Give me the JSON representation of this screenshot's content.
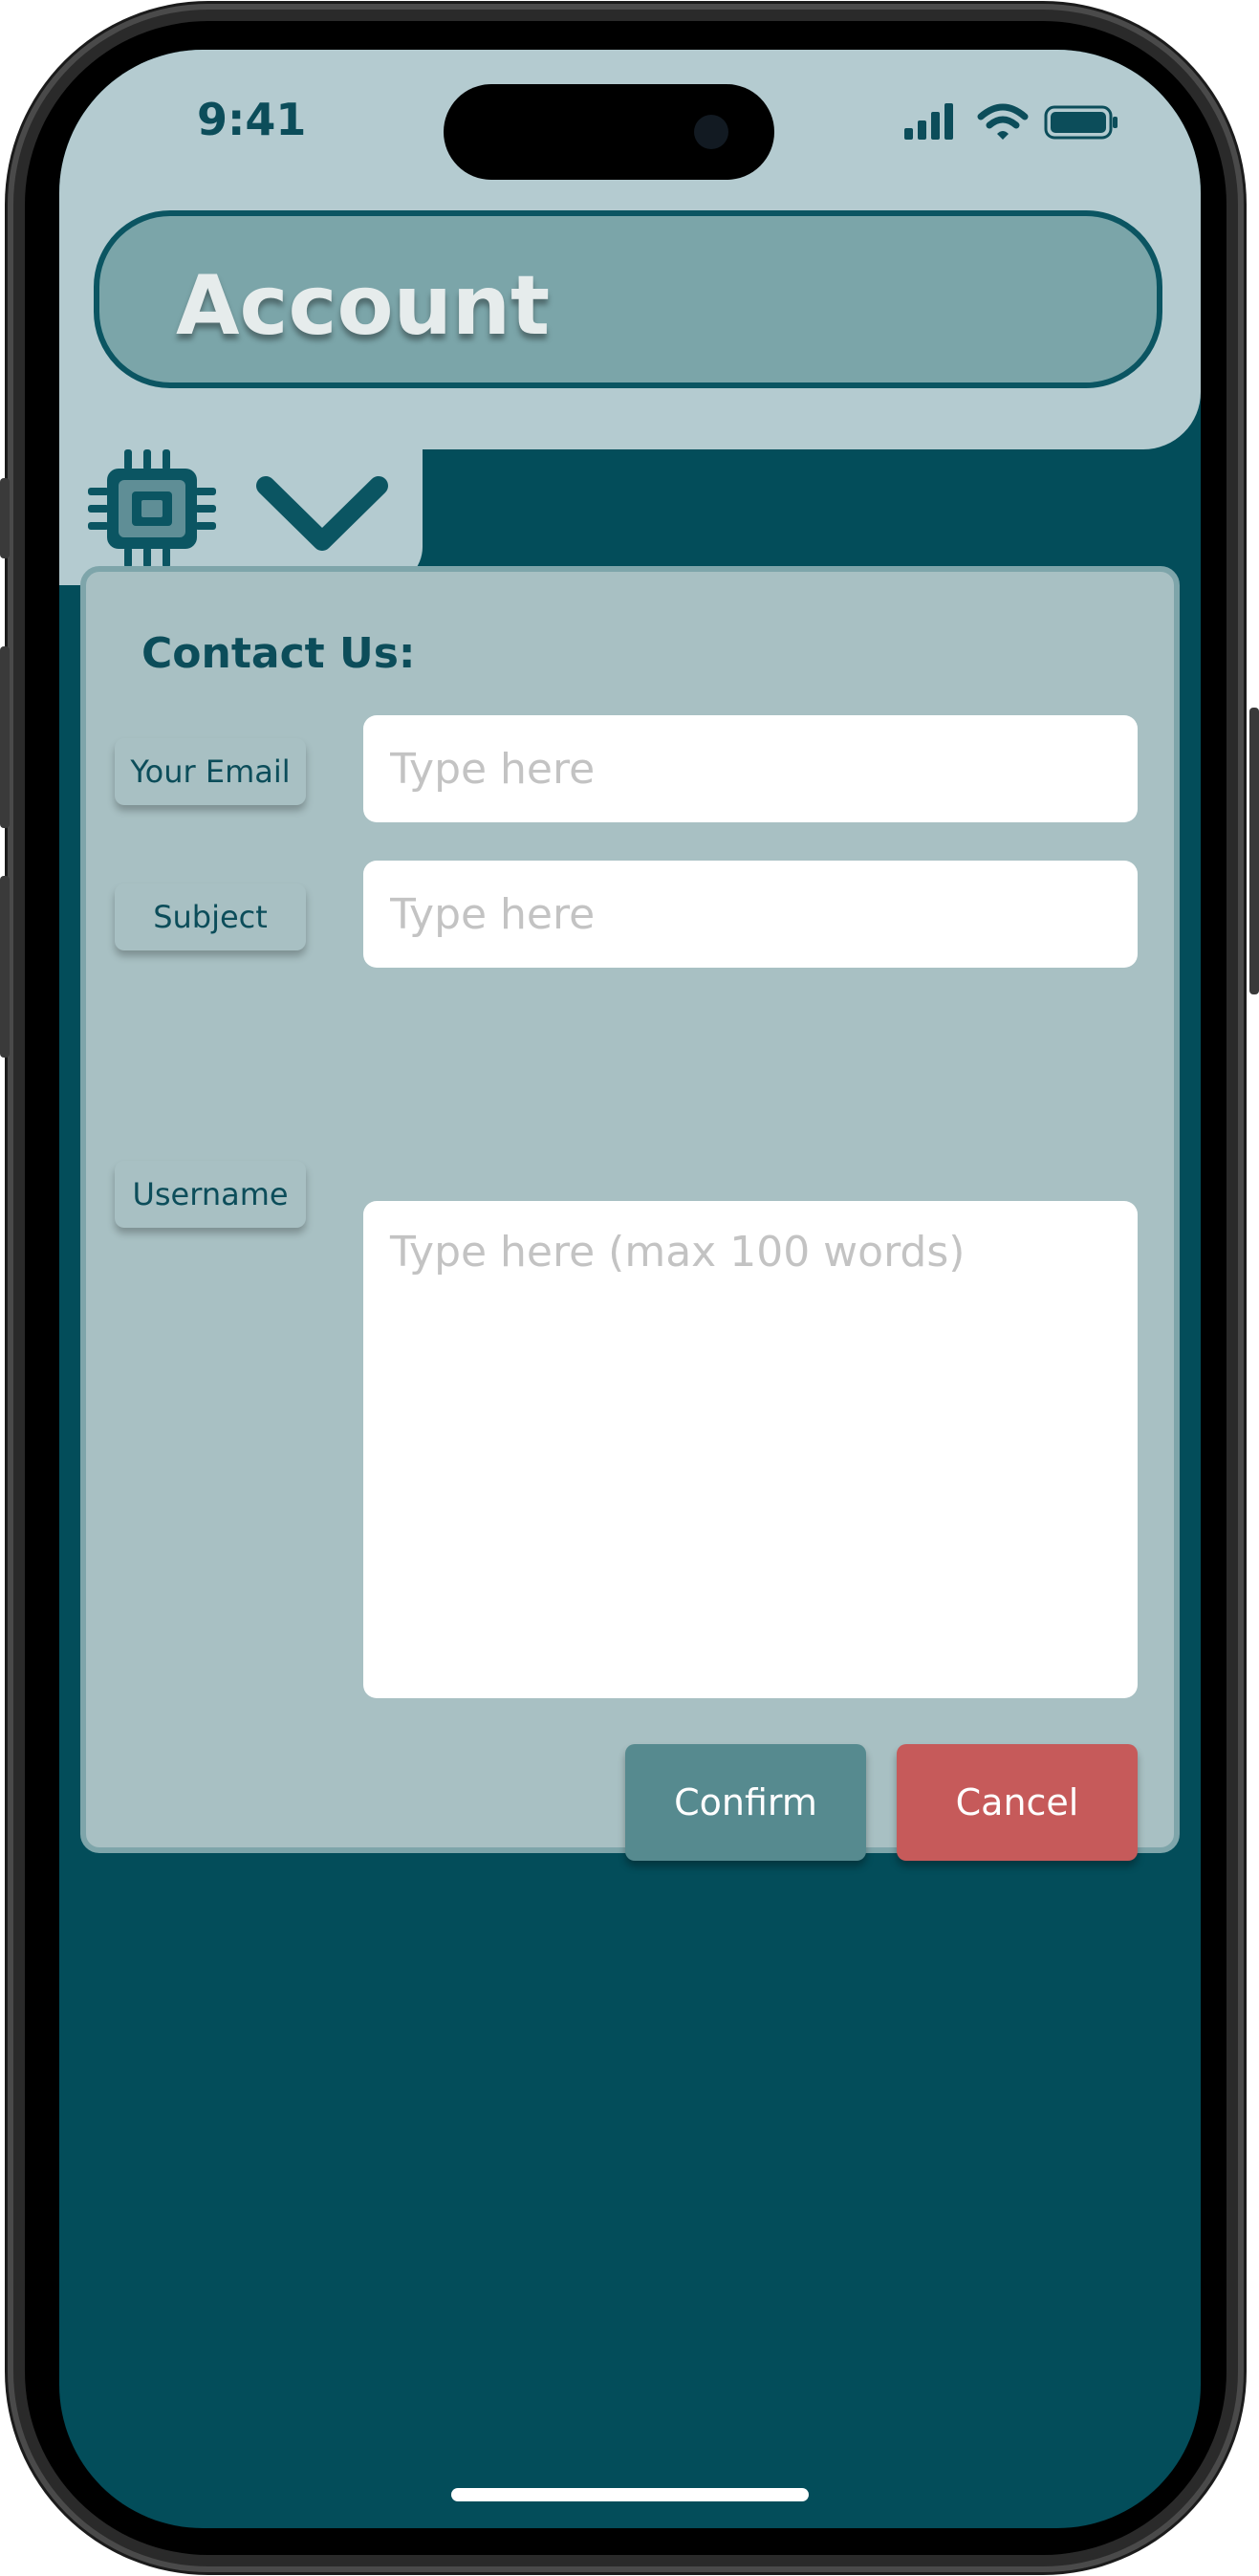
{
  "status": {
    "time": "9:41",
    "signal_icon": "signal-bars-icon",
    "wifi_icon": "wifi-icon",
    "battery_icon": "battery-icon"
  },
  "header": {
    "title": "Account",
    "chip_icon": "cpu-chip-icon",
    "toggle_icon": "chevron-down-icon"
  },
  "form": {
    "title": "Contact Us:",
    "email_label": "Your Email",
    "email_placeholder": "Type here",
    "subject_label": "Subject",
    "subject_placeholder": "Type here",
    "username_label": "Username",
    "message_placeholder": "Type here (max 100 words)",
    "confirm_label": "Confirm",
    "cancel_label": "Cancel"
  },
  "colors": {
    "background": "#034d5a",
    "header_bg": "#b4cbd0",
    "account_bar": "#7ba5a9",
    "card_bg": "#a8c0c3",
    "confirm": "#568a8f",
    "cancel": "#c65a5a"
  }
}
